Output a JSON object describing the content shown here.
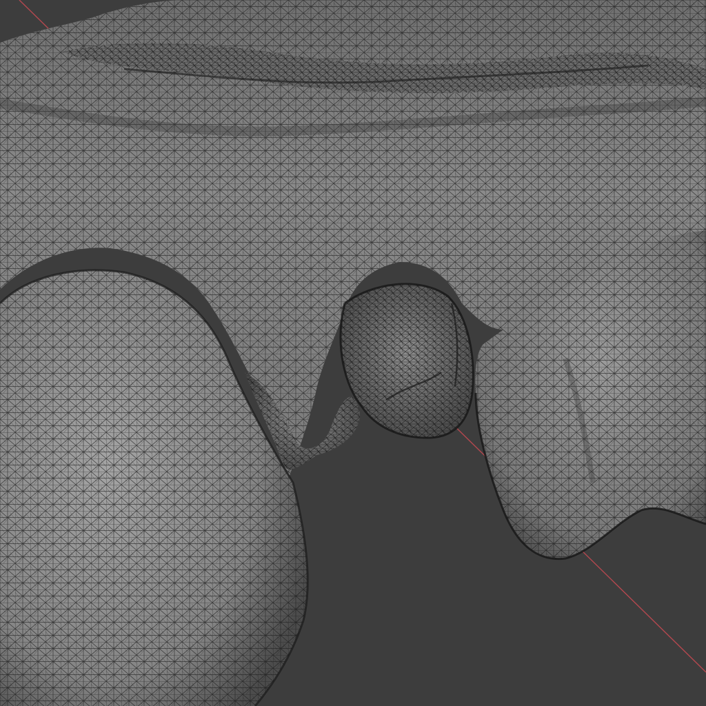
{
  "viewport": {
    "background_color": "#3d3d3d",
    "axis_color": "#b5484f",
    "mesh_base_color": "#7d7d7d",
    "wire_color": "#1c1c1c",
    "shading": "wireframe-over-solid"
  }
}
